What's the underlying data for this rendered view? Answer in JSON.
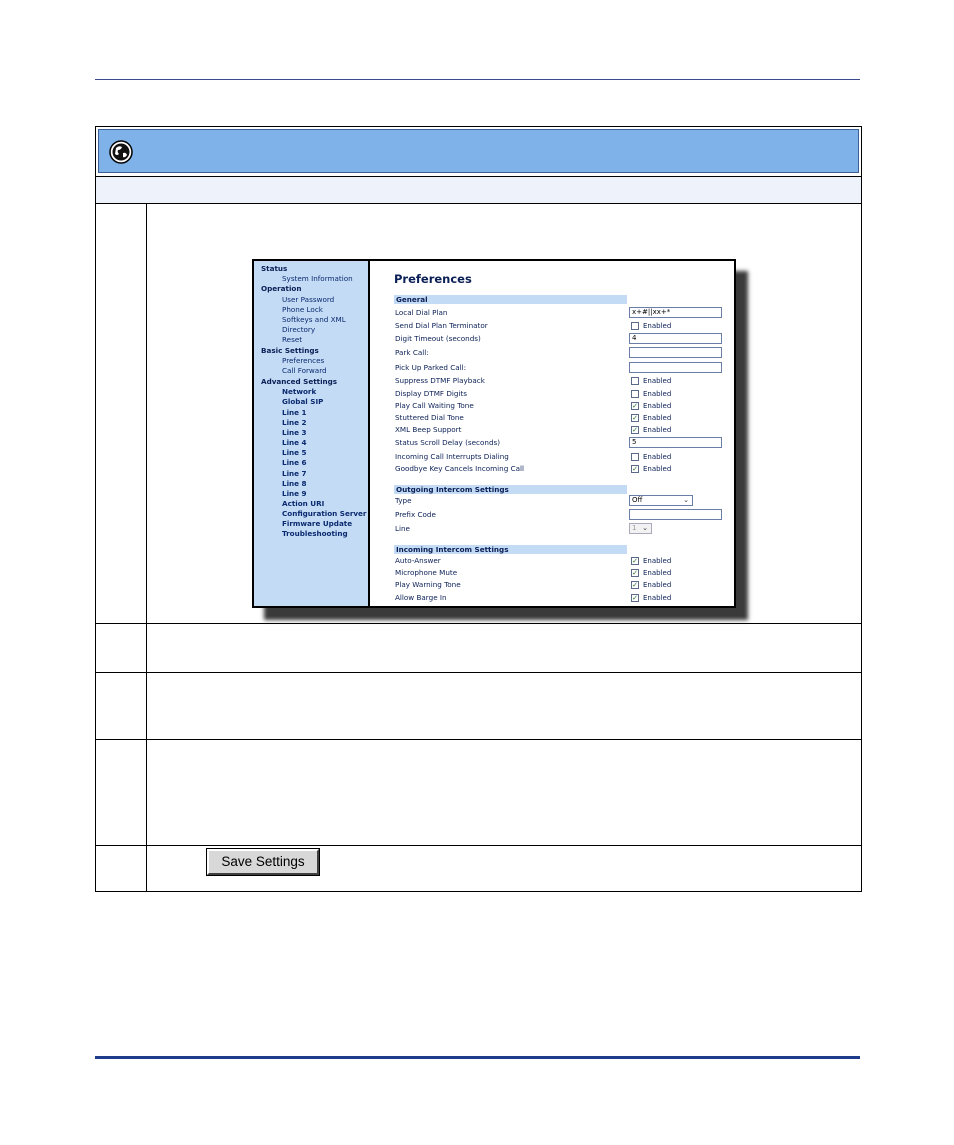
{
  "webui": {
    "nav": [
      {
        "label": "Status",
        "kind": "sec"
      },
      {
        "label": "System Information",
        "kind": "sub"
      },
      {
        "label": "Operation",
        "kind": "sec"
      },
      {
        "label": "User Password",
        "kind": "sub"
      },
      {
        "label": "Phone Lock",
        "kind": "sub"
      },
      {
        "label": "Softkeys and XML",
        "kind": "sub"
      },
      {
        "label": "Directory",
        "kind": "sub"
      },
      {
        "label": "Reset",
        "kind": "sub"
      },
      {
        "label": "Basic Settings",
        "kind": "sec"
      },
      {
        "label": "Preferences",
        "kind": "sub"
      },
      {
        "label": "Call Forward",
        "kind": "sub"
      },
      {
        "label": "Advanced Settings",
        "kind": "sec"
      },
      {
        "label": "Network",
        "kind": "sub"
      },
      {
        "label": "Global SIP",
        "kind": "sub"
      },
      {
        "label": "Line 1",
        "kind": "sub"
      },
      {
        "label": "Line 2",
        "kind": "sub"
      },
      {
        "label": "Line 3",
        "kind": "sub"
      },
      {
        "label": "Line 4",
        "kind": "sub"
      },
      {
        "label": "Line 5",
        "kind": "sub"
      },
      {
        "label": "Line 6",
        "kind": "sub"
      },
      {
        "label": "Line 7",
        "kind": "sub"
      },
      {
        "label": "Line 8",
        "kind": "sub"
      },
      {
        "label": "Line 9",
        "kind": "sub"
      },
      {
        "label": "Action URI",
        "kind": "sub"
      },
      {
        "label": "Configuration Server",
        "kind": "sub"
      },
      {
        "label": "Firmware Update",
        "kind": "sub"
      },
      {
        "label": "Troubleshooting",
        "kind": "sub"
      }
    ],
    "title": "Preferences",
    "enabled_label": "Enabled",
    "sections": {
      "general": "General",
      "outgoing": "Outgoing Intercom Settings",
      "incoming": "Incoming Intercom Settings"
    },
    "general": {
      "local_dial_plan": {
        "label": "Local Dial Plan",
        "value": "x+#||xx+*"
      },
      "send_terminator": {
        "label": "Send Dial Plan Terminator",
        "checked": false
      },
      "digit_timeout": {
        "label": "Digit Timeout (seconds)",
        "value": "4"
      },
      "park_call": {
        "label": "Park Call:",
        "value": ""
      },
      "pickup_parked": {
        "label": "Pick Up Parked Call:",
        "value": ""
      },
      "suppress_dtmf": {
        "label": "Suppress DTMF Playback",
        "checked": false
      },
      "display_dtmf": {
        "label": "Display DTMF Digits",
        "checked": false
      },
      "call_waiting_tone": {
        "label": "Play Call Waiting Tone",
        "checked": true
      },
      "stuttered_tone": {
        "label": "Stuttered Dial Tone",
        "checked": true
      },
      "xml_beep": {
        "label": "XML Beep Support",
        "checked": true
      },
      "status_scroll": {
        "label": "Status Scroll Delay (seconds)",
        "value": "5"
      },
      "incoming_interrupts": {
        "label": "Incoming Call Interrupts Dialing",
        "checked": false
      },
      "goodbye_cancels": {
        "label": "Goodbye Key Cancels Incoming Call",
        "checked": true
      }
    },
    "outgoing": {
      "type": {
        "label": "Type",
        "value": "Off"
      },
      "prefix": {
        "label": "Prefix Code",
        "value": ""
      },
      "line": {
        "label": "Line",
        "value": "1"
      }
    },
    "incoming": {
      "auto_answer": {
        "label": "Auto-Answer",
        "checked": true
      },
      "mic_mute": {
        "label": "Microphone Mute",
        "checked": true
      },
      "warning_tone": {
        "label": "Play Warning Tone",
        "checked": true
      },
      "barge_in": {
        "label": "Allow Barge In",
        "checked": true
      }
    }
  },
  "save_button": "Save Settings"
}
